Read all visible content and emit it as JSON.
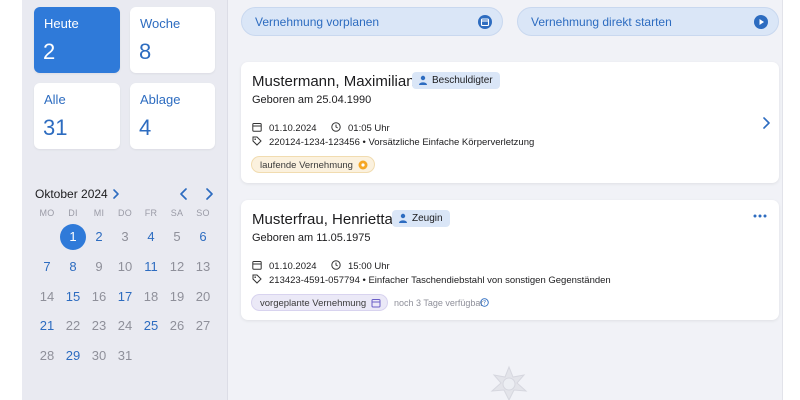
{
  "tiles": {
    "heute": {
      "label": "Heute",
      "count": "2"
    },
    "woche": {
      "label": "Woche",
      "count": "8"
    },
    "alle": {
      "label": "Alle",
      "count": "31"
    },
    "ablage": {
      "label": "Ablage",
      "count": "4"
    }
  },
  "calendar": {
    "month_label": "Oktober 2024",
    "weekdays": [
      "MO",
      "DI",
      "MI",
      "DO",
      "FR",
      "SA",
      "SO"
    ],
    "days": [
      "1",
      "2",
      "3",
      "4",
      "5",
      "6",
      "7",
      "8",
      "9",
      "10",
      "11",
      "12",
      "13",
      "14",
      "15",
      "16",
      "17",
      "18",
      "19",
      "20",
      "21",
      "22",
      "23",
      "24",
      "25",
      "26",
      "27",
      "28",
      "29",
      "30",
      "31"
    ],
    "highlighted_days": [
      "1",
      "2",
      "4",
      "6",
      "7",
      "8",
      "11",
      "15",
      "17",
      "21",
      "25",
      "29"
    ],
    "selected_day": "1",
    "icons": {
      "month_chevron": "chevron-right-icon",
      "prev": "chevron-left-icon",
      "next": "chevron-right-icon"
    }
  },
  "actions": {
    "plan_label": "Vernehmung vorplanen",
    "plan_icon": "calendar-icon",
    "start_label": "Vernehmung direkt starten",
    "start_icon": "play-icon"
  },
  "cases": [
    {
      "name": "Mustermann, Maximilian",
      "role": "Beschuldigter",
      "birth": "Geboren am  25.04.1990",
      "date": "01.10.2024",
      "time": "01:05 Uhr",
      "case_ref": "220124-1234-123456  •  Vorsätzliche Einfache Körperverletzung",
      "status": "laufende Vernehmung",
      "status_color": "#f5a623"
    },
    {
      "name": "Musterfrau, Henrietta",
      "role": "Zeugin",
      "birth": "Geboren am  11.05.1975",
      "date": "01.10.2024",
      "time": "15:00 Uhr",
      "case_ref": "213423-4591-057794  •  Einfacher Taschendiebstahl von sonstigen Gegenständen",
      "status": "vorgeplante Vernehmung",
      "status_color": "#6b5fc7",
      "availability": "noch 3 Tage verfügbar"
    }
  ],
  "colors": {
    "accent": "#2f7ad9",
    "accent_text": "#2d6cc0",
    "background": "#f1f2f7"
  }
}
